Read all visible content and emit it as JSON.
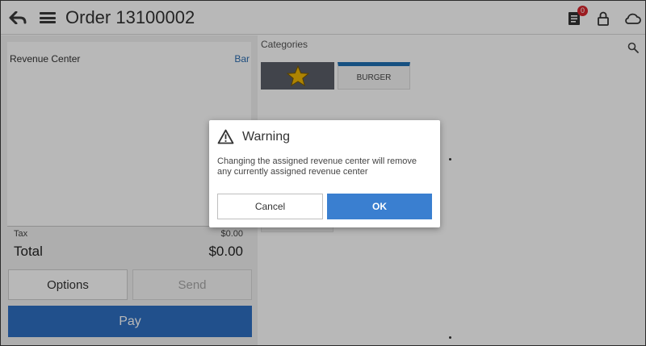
{
  "header": {
    "title": "Order 13100002",
    "notification_count": "0"
  },
  "ticket": {
    "revenue_center_label": "Revenue Center",
    "revenue_center_value": "Bar",
    "tax_label": "Tax",
    "tax_value": "$0.00",
    "total_label": "Total",
    "total_value": "$0.00"
  },
  "actions": {
    "options_label": "Options",
    "send_label": "Send",
    "pay_label": "Pay"
  },
  "categories": {
    "label": "Categories",
    "tiles": [
      {
        "label": "",
        "icon": "star-icon",
        "color": "#5a5f68"
      },
      {
        "label": "BURGER",
        "accent": "#1f6fb3"
      }
    ]
  },
  "dialog": {
    "title": "Warning",
    "message": "Changing the assigned revenue center will remove any currently assigned revenue center",
    "cancel_label": "Cancel",
    "ok_label": "OK"
  },
  "colors": {
    "primary": "#2e6fc2",
    "dialog_ok": "#3a7fd0",
    "badge": "#d9262d",
    "star": "#f2b705"
  }
}
